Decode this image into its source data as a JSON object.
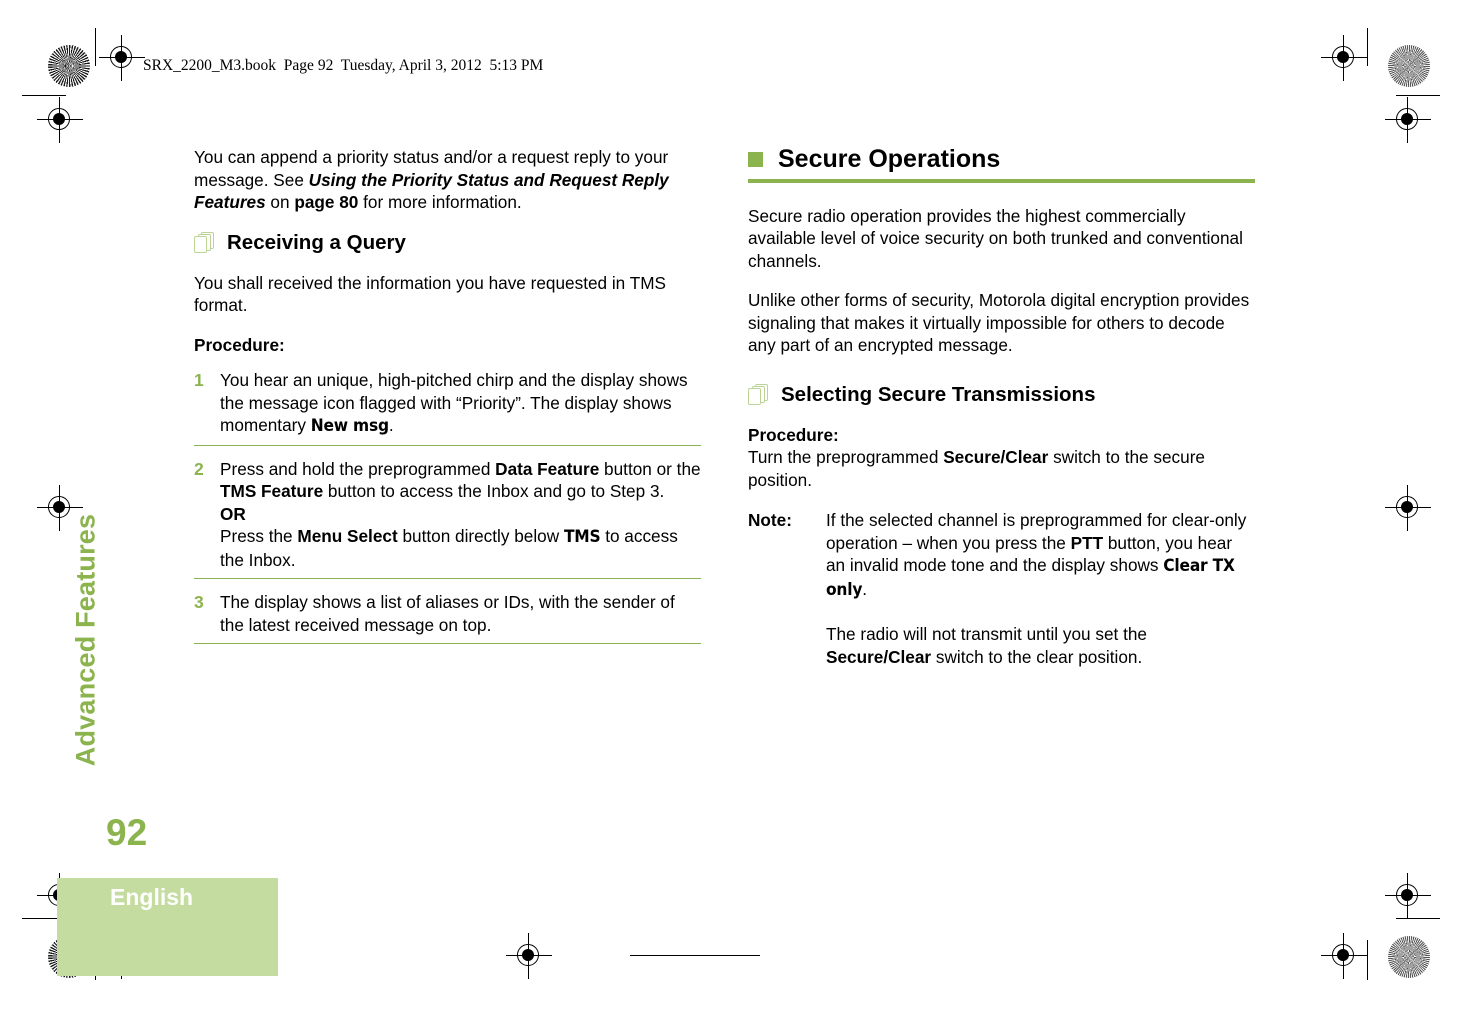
{
  "header": {
    "file_line": "SRX_2200_M3.book  Page 92  Tuesday, April 3, 2012  5:13 PM"
  },
  "chapter": {
    "title": "Advanced Features"
  },
  "footer": {
    "page_number": "92",
    "language": "English"
  },
  "colors": {
    "accent_green": "#8CB44E",
    "pale_green": "#C5DCA0",
    "icon_green": "#BBD496"
  },
  "left_column": {
    "intro": {
      "part1": "You can append a priority status and/or a request reply to your message. See ",
      "bold_italic_ref": "Using the Priority Status and Request Reply Features",
      "part2": " on ",
      "bold_page": "page 80",
      "part3": " for more information."
    },
    "section_heading": "Receiving a Query",
    "section_icon": "stacked-pages-icon",
    "lead": "You shall received the information you have requested in TMS format.",
    "procedure_label": "Procedure:",
    "steps": [
      {
        "number": "1",
        "part1": "You hear an unique, high-pitched chirp and the display shows the message icon flagged with “Priority”. The display shows momentary ",
        "lcd1": "New msg",
        "part2": "."
      },
      {
        "number": "2",
        "part1": "Press and hold the preprogrammed ",
        "bold1": "Data Feature",
        "part2": " button or the ",
        "bold2": "TMS Feature",
        "part3": " button to access the Inbox and go to Step 3.",
        "or_label": "OR",
        "part4": "Press the ",
        "bold3": "Menu Select",
        "part5": " button directly below ",
        "lcd1": "TMS",
        "part6": " to access the Inbox."
      },
      {
        "number": "3",
        "part1": "The display shows a list of aliases or IDs, with the sender of the latest received message on top."
      }
    ]
  },
  "right_column": {
    "main_heading": "Secure Operations",
    "main_bullet": "square-bullet",
    "paragraph1": "Secure radio operation provides the highest commercially available level of voice security on both trunked and conventional channels.",
    "paragraph2": "Unlike other forms of security, Motorola digital encryption provides signaling that makes it virtually impossible for others to decode any part of an encrypted message.",
    "section_heading": "Selecting Secure Transmissions",
    "section_icon": "stacked-pages-icon",
    "procedure_label": "Procedure:",
    "procedure_text": {
      "part1": "Turn the preprogrammed ",
      "bold1": "Secure/Clear",
      "part2": " switch to the secure position."
    },
    "note": {
      "label": "Note:",
      "p1": {
        "part1": "If the selected channel is preprogrammed for clear-only operation – when you press the ",
        "bold1": "PTT",
        "part2": " button, you hear an invalid mode tone and the display shows ",
        "lcd1": "Clear TX only",
        "part3": "."
      },
      "p2": {
        "part1": "The radio will not transmit until you set the ",
        "bold1": "Secure/Clear",
        "part2": " switch to the clear position."
      }
    }
  }
}
